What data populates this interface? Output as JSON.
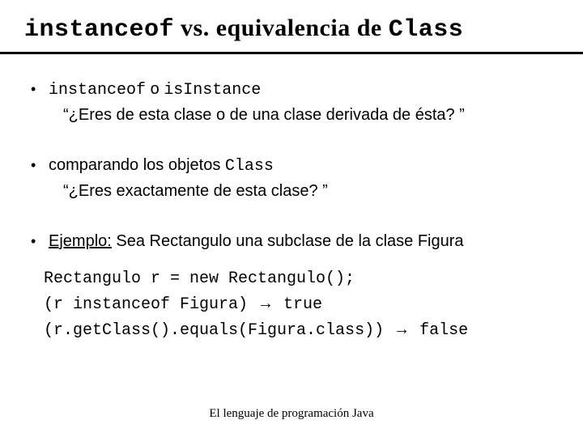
{
  "title": {
    "part1": "instanceof",
    "part2": " vs. equivalencia de ",
    "part3": "Class"
  },
  "bullets": {
    "b1": {
      "code1": "instanceof",
      "mid": " o ",
      "code2": "isInstance",
      "sub": "“¿Eres de esta clase o de una clase derivada de ésta? ”"
    },
    "b2": {
      "line_pre": "comparando los objetos ",
      "line_code": "Class",
      "sub": "“¿Eres exactamente de esta clase? ”"
    },
    "b3": {
      "label": "Ejemplo:",
      "rest": " Sea Rectangulo una subclase de la clase Figura"
    }
  },
  "code": {
    "l1": "Rectangulo r = new Rectangulo();",
    "l2a": "(r instanceof Figura) ",
    "l2b": " true",
    "l3a": "(r.getClass().equals(Figura.class)) ",
    "l3b": " false"
  },
  "arrow": "→",
  "footer": "El lenguaje de programación Java"
}
